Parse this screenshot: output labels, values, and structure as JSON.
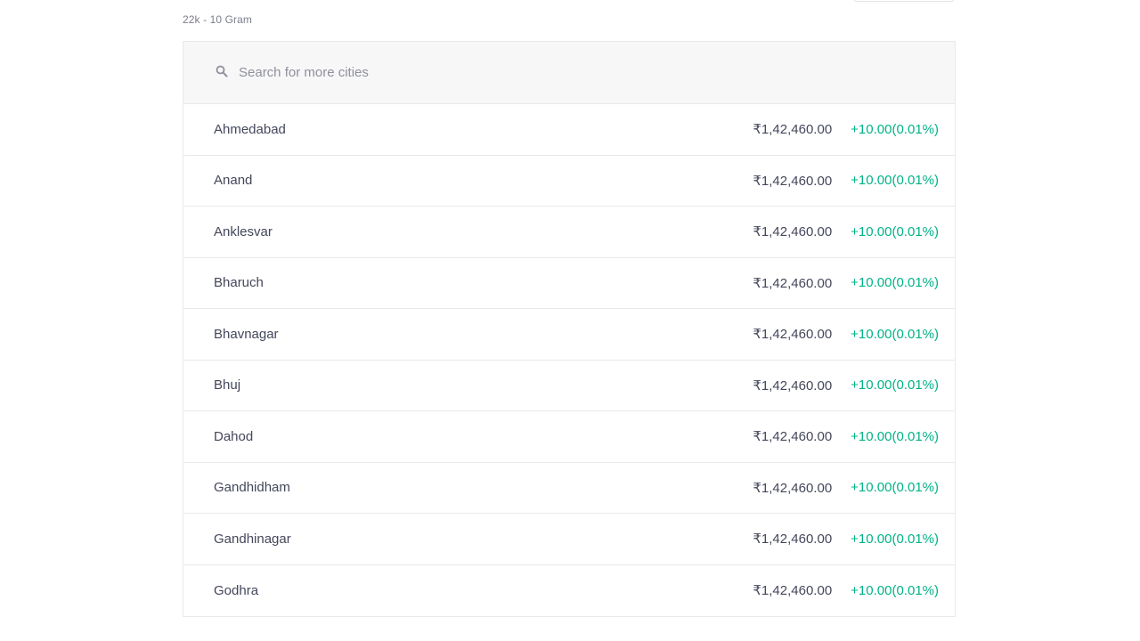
{
  "unit_label": "22k - 10 Gram",
  "search": {
    "placeholder": "Search for more cities",
    "icon": "search-icon"
  },
  "colors": {
    "positive_change": "#00b386",
    "text": "#44475b",
    "muted": "#7c7e8c",
    "search_bg": "#f7f7f8",
    "border": "#e9e9eb"
  },
  "rows": [
    {
      "city": "Ahmedabad",
      "price": "₹1,42,460.00",
      "change": "+10.00(0.01%)"
    },
    {
      "city": "Anand",
      "price": "₹1,42,460.00",
      "change": "+10.00(0.01%)"
    },
    {
      "city": "Anklesvar",
      "price": "₹1,42,460.00",
      "change": "+10.00(0.01%)"
    },
    {
      "city": "Bharuch",
      "price": "₹1,42,460.00",
      "change": "+10.00(0.01%)"
    },
    {
      "city": "Bhavnagar",
      "price": "₹1,42,460.00",
      "change": "+10.00(0.01%)"
    },
    {
      "city": "Bhuj",
      "price": "₹1,42,460.00",
      "change": "+10.00(0.01%)"
    },
    {
      "city": "Dahod",
      "price": "₹1,42,460.00",
      "change": "+10.00(0.01%)"
    },
    {
      "city": "Gandhidham",
      "price": "₹1,42,460.00",
      "change": "+10.00(0.01%)"
    },
    {
      "city": "Gandhinagar",
      "price": "₹1,42,460.00",
      "change": "+10.00(0.01%)"
    },
    {
      "city": "Godhra",
      "price": "₹1,42,460.00",
      "change": "+10.00(0.01%)"
    }
  ]
}
